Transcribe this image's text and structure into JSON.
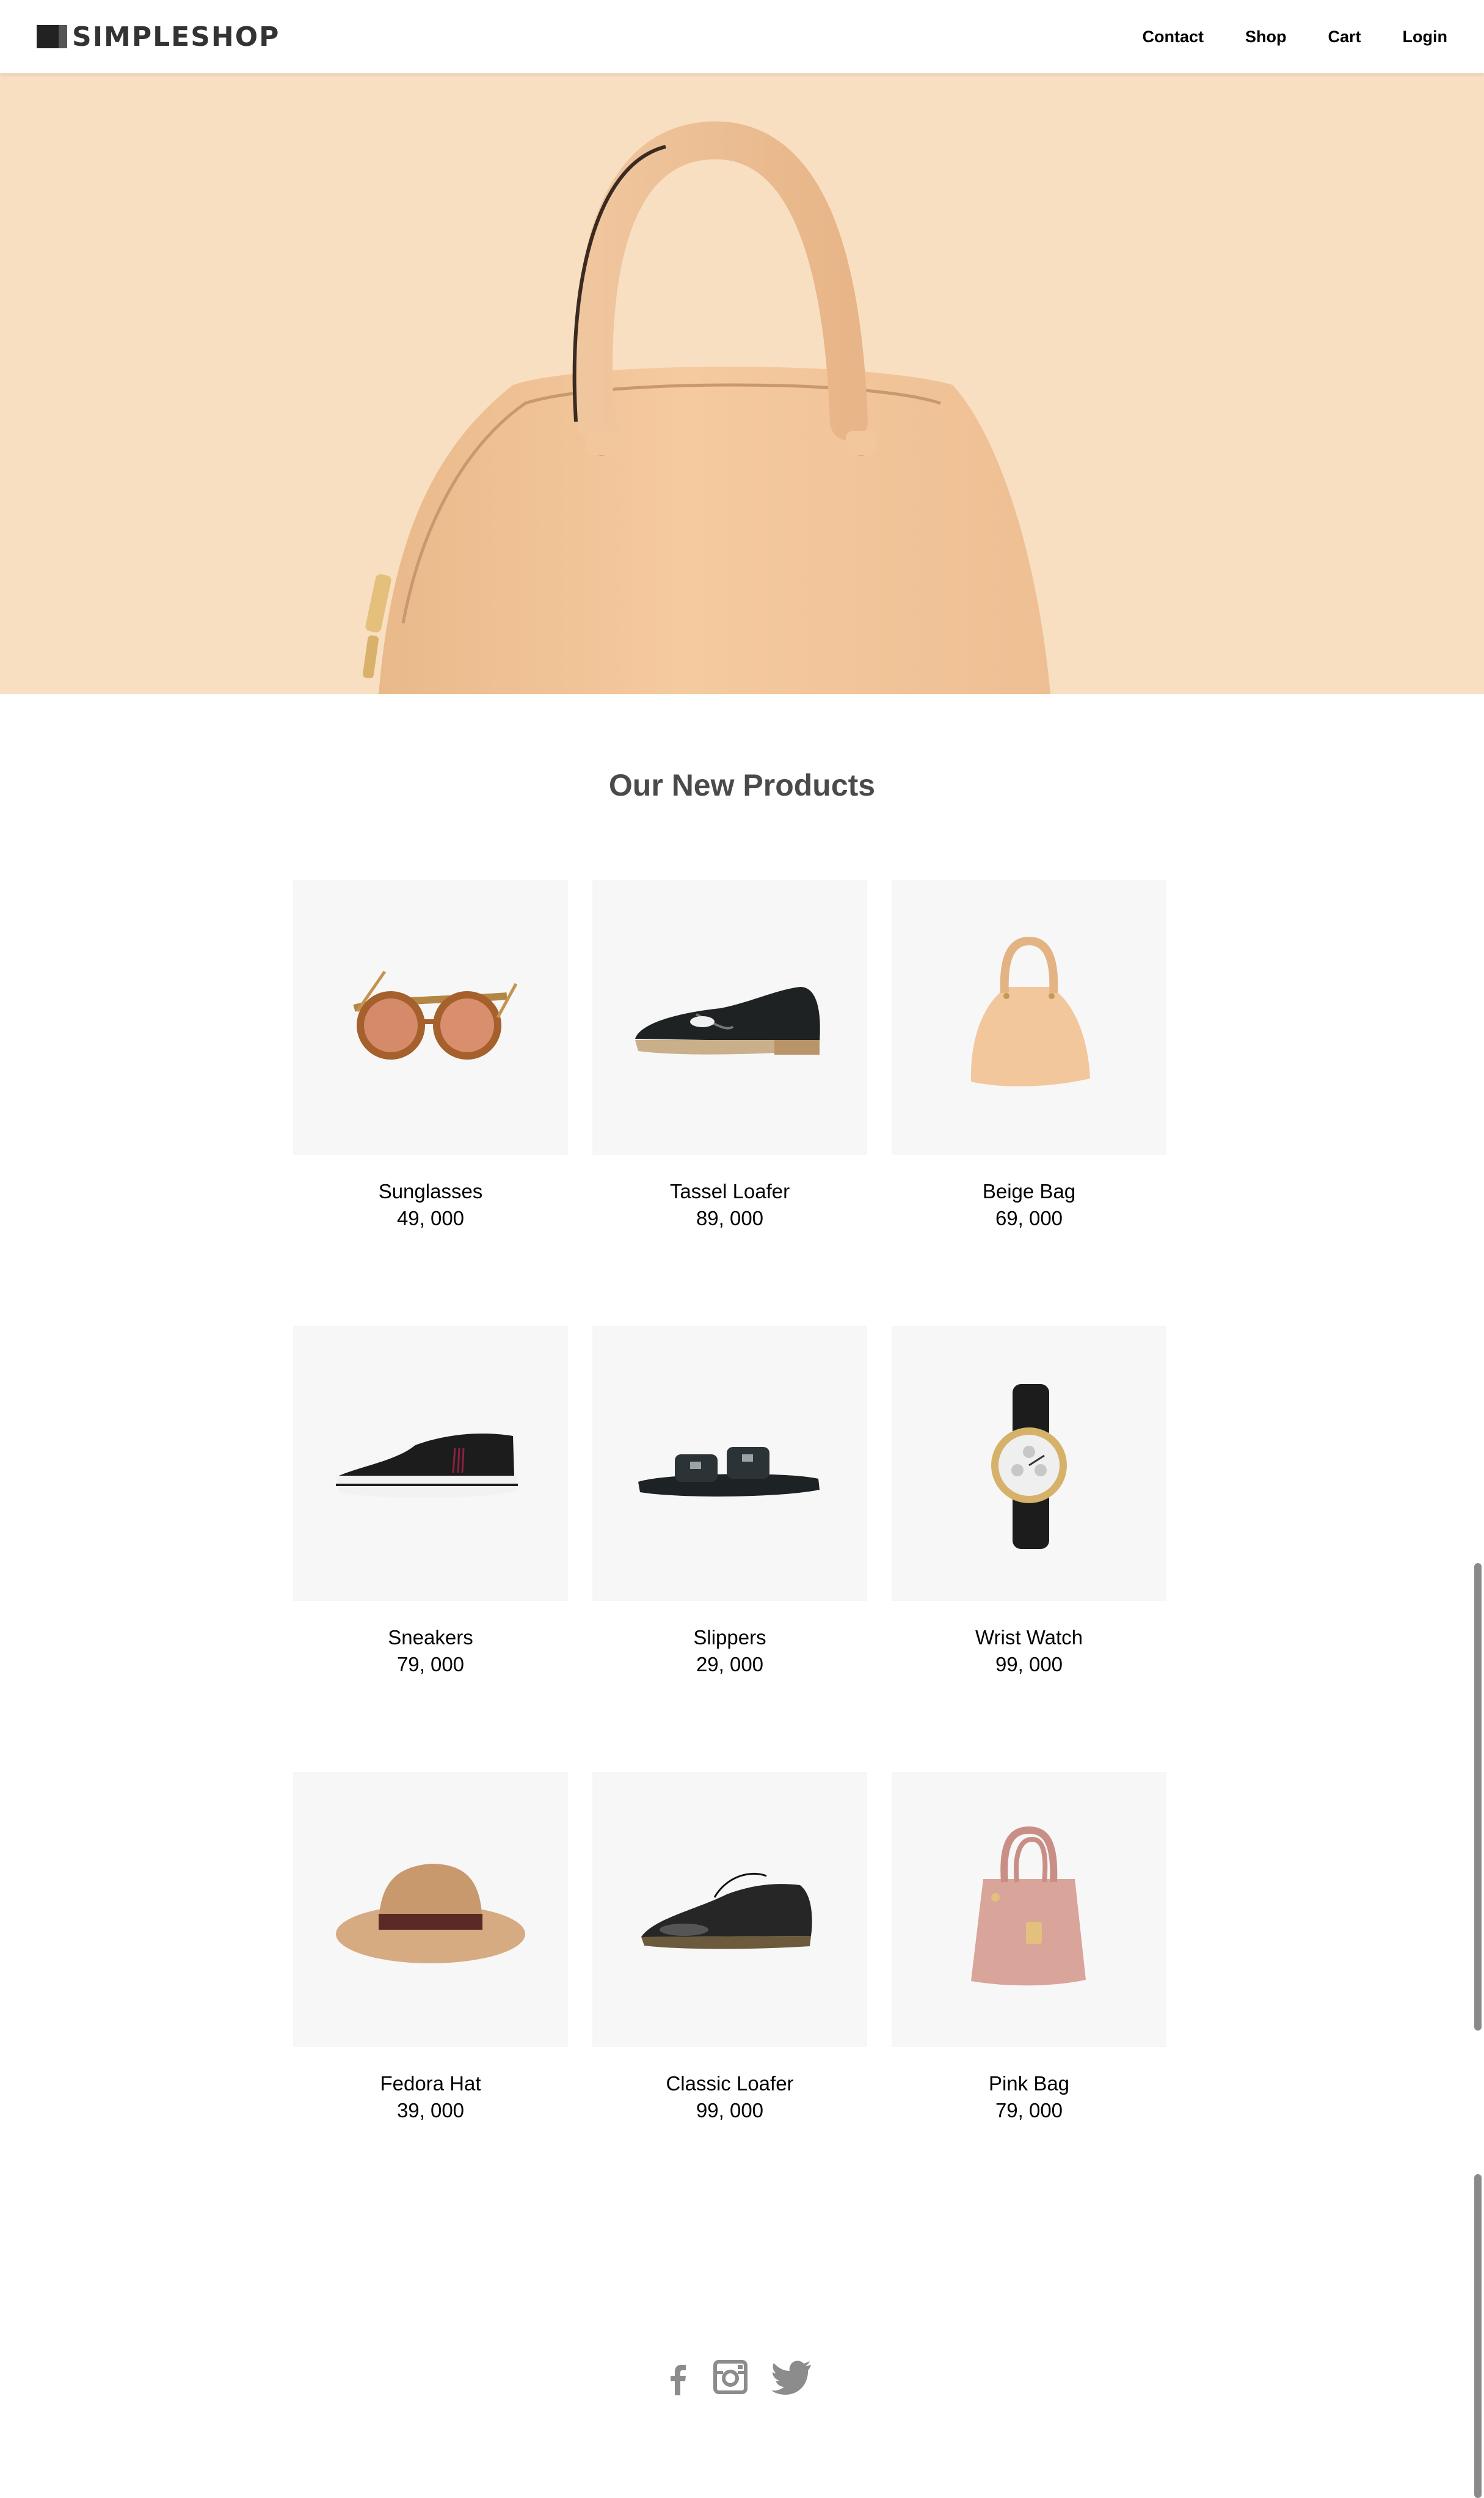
{
  "brand": {
    "name": "SIMPLESHOP"
  },
  "nav": {
    "items": [
      "Contact",
      "Shop",
      "Cart",
      "Login"
    ]
  },
  "hero": {
    "image": "beige-handbag-hero",
    "background": "#f8dfc2"
  },
  "section": {
    "title": "Our New Products"
  },
  "products": [
    {
      "name": "Sunglasses",
      "price": "49, 000",
      "icon": "sunglasses"
    },
    {
      "name": "Tassel Loafer",
      "price": "89, 000",
      "icon": "tassel-loafer"
    },
    {
      "name": "Beige Bag",
      "price": "69, 000",
      "icon": "beige-bag"
    },
    {
      "name": "Sneakers",
      "price": "79, 000",
      "icon": "sneaker"
    },
    {
      "name": "Slippers",
      "price": "29, 000",
      "icon": "slipper"
    },
    {
      "name": "Wrist Watch",
      "price": "99, 000",
      "icon": "wrist-watch"
    },
    {
      "name": "Fedora Hat",
      "price": "39, 000",
      "icon": "fedora-hat"
    },
    {
      "name": "Classic Loafer",
      "price": "99, 000",
      "icon": "classic-loafer"
    },
    {
      "name": "Pink Bag",
      "price": "79, 000",
      "icon": "pink-bag"
    }
  ],
  "social": [
    "facebook-icon",
    "instagram-icon",
    "twitter-icon"
  ],
  "colors": {
    "tile": "#f7f7f7",
    "hero": "#f8dfc2",
    "social": "#8c8c8c",
    "title": "#4a4a4a"
  }
}
